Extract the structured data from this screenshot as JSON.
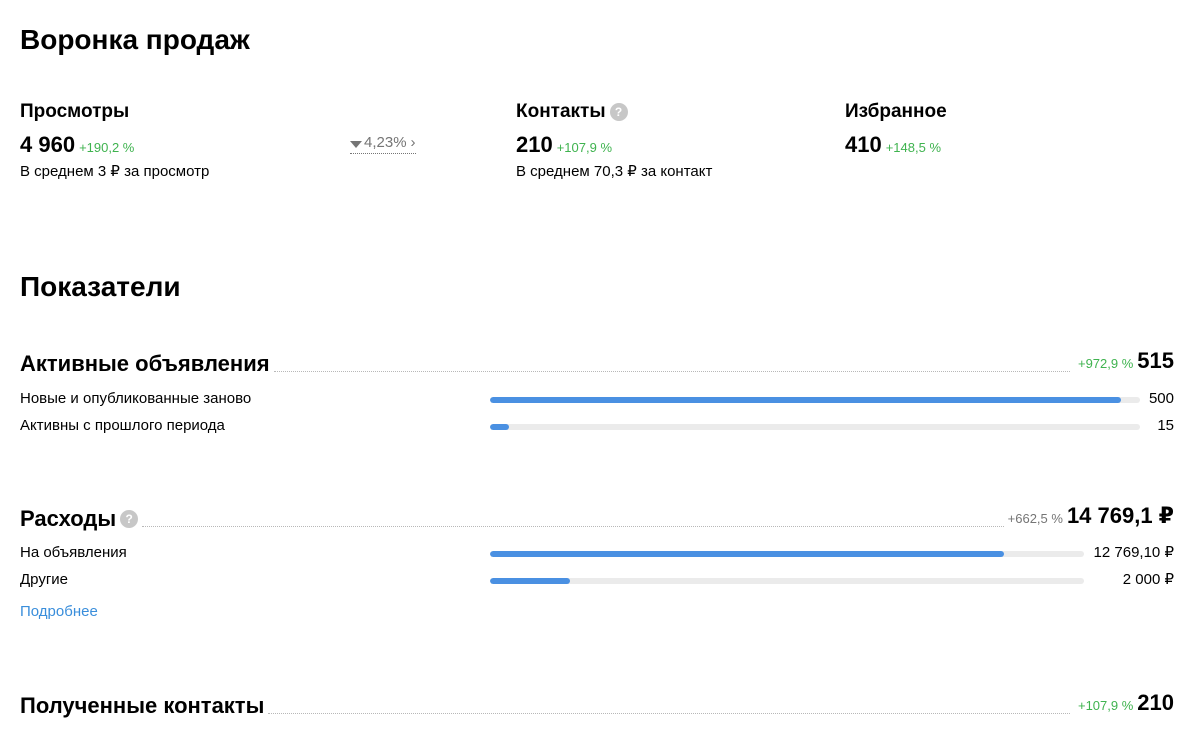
{
  "funnel": {
    "title": "Воронка продаж",
    "views": {
      "title": "Просмотры",
      "value": "4 960",
      "delta": "+190,2 %",
      "avg": "В среднем 3 ₽ за просмотр"
    },
    "conversion": {
      "value": "4,23%",
      "fraction": 0.0423
    },
    "contacts": {
      "title": "Контакты",
      "value": "210",
      "delta": "+107,9 %",
      "avg": "В среднем 70,3 ₽ за контакт"
    },
    "favorites": {
      "title": "Избранное",
      "value": "410",
      "delta": "+148,5 %"
    }
  },
  "indicators": {
    "title": "Показатели",
    "active_ads": {
      "title": "Активные объявления",
      "delta": "+972,9 %",
      "value": "515",
      "rows": [
        {
          "label": "Новые и опубликованные заново",
          "value": "500",
          "fraction": 0.971
        },
        {
          "label": "Активны с прошлого периода",
          "value": "15",
          "fraction": 0.029
        }
      ]
    },
    "expenses": {
      "title": "Расходы",
      "delta": "+662,5 %",
      "value": "14 769,1 ₽",
      "rows": [
        {
          "label": "На объявления",
          "value": "12 769,10 ₽",
          "fraction": 0.865
        },
        {
          "label": "Другие",
          "value": "2 000 ₽",
          "fraction": 0.135
        }
      ],
      "more_link": "Подробнее"
    },
    "received_contacts": {
      "title": "Полученные контакты",
      "delta": "+107,9 %",
      "value": "210"
    }
  },
  "icons": {
    "help": "?",
    "funnel": "funnel-icon",
    "chevron": "›"
  },
  "colors": {
    "positive": "#3fb34f",
    "neutral": "#757575",
    "bar": "#4a90e2",
    "track": "#ebebeb",
    "link": "#3a8edb"
  }
}
